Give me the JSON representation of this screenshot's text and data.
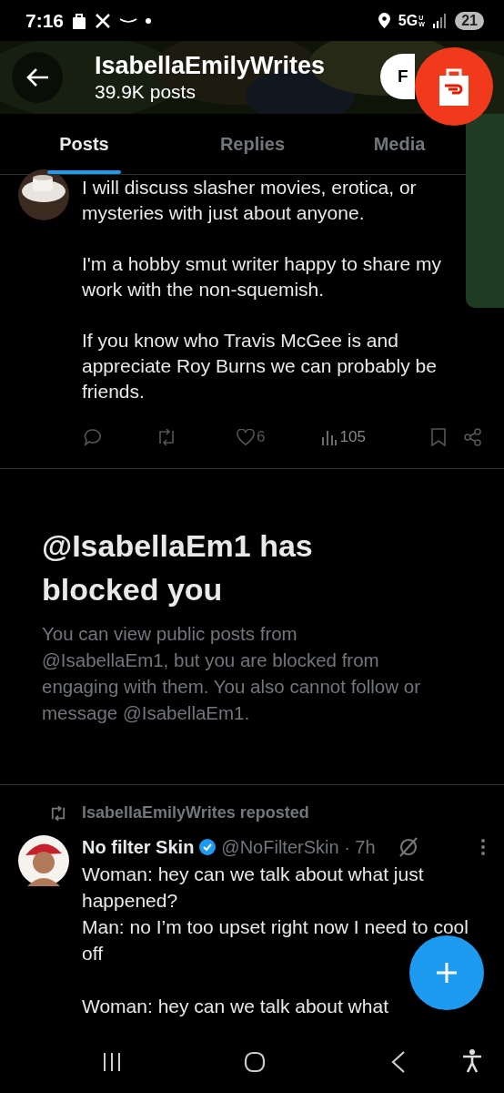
{
  "status_bar": {
    "time": "7:16",
    "network": "5G",
    "network_sub": "UW",
    "battery": "21"
  },
  "header": {
    "title": "IsabellaEmilyWrites",
    "subtitle": "39.9K posts",
    "follow_button": "F"
  },
  "tabs": [
    {
      "label": "Posts",
      "selected": true
    },
    {
      "label": "Replies",
      "selected": false
    },
    {
      "label": "Media",
      "selected": false
    }
  ],
  "post": {
    "paragraphs": [
      "I will discuss slasher movies, erotica, or mysteries with just about anyone.",
      "I'm a hobby smut writer happy to share my work with the non-squemish.",
      "If you know who Travis McGee is and appreciate Roy Burns we can probably be friends."
    ],
    "likes": "6",
    "views": "105"
  },
  "blocked": {
    "title": "@IsabellaEm1 has blocked you",
    "message": "You can view public posts from @IsabellaEm1, but you are blocked from engaging with them. You also cannot follow or message @IsabellaEm1."
  },
  "repost": {
    "label": "IsabellaEmilyWrites reposted",
    "name": "No filter Skin",
    "handle": "@NoFilterSkin · 7h",
    "paragraphs": [
      "Woman: hey can we talk about what just happened?\nMan: no I’m too upset right now I need to cool off",
      "Woman: hey can we talk about what"
    ]
  }
}
